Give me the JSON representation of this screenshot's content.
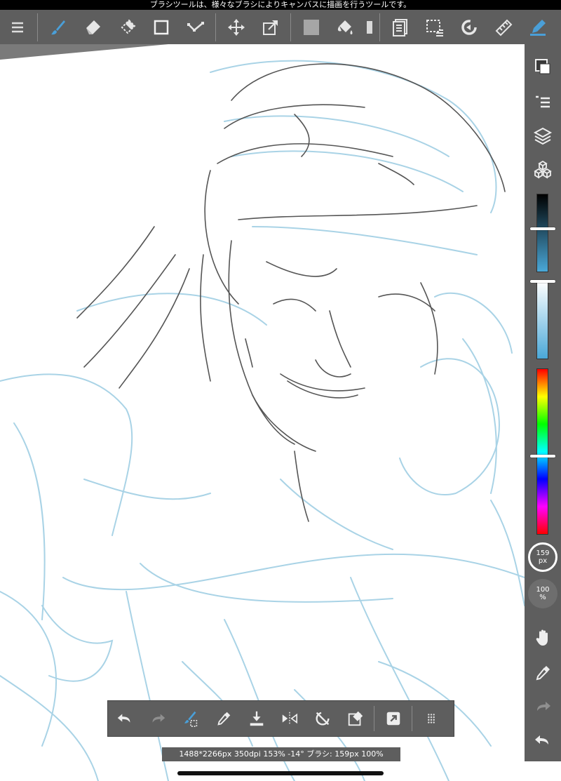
{
  "statusbar": {
    "message": "ブラシツールは、様々なブラシによりキャンバスに描画を行うツールです。"
  },
  "toolbar": {
    "tools": [
      {
        "icon": "menu-icon",
        "name": "menu-button"
      },
      {
        "icon": "brush-icon",
        "name": "brush-tool-button",
        "active": true
      },
      {
        "icon": "eraser-icon",
        "name": "eraser-tool-button"
      },
      {
        "icon": "blur-eraser-icon",
        "name": "blur-tool-button"
      },
      {
        "icon": "shape-rect-icon",
        "name": "shape-tool-button"
      },
      {
        "icon": "line-tool-icon",
        "name": "edit-tool-button"
      },
      {
        "icon": "move-icon",
        "name": "move-tool-button"
      },
      {
        "icon": "transform-icon",
        "name": "transform-tool-button"
      },
      {
        "icon": "fill-color-icon",
        "name": "fill-color-button"
      },
      {
        "icon": "bucket-icon",
        "name": "bucket-tool-button"
      },
      {
        "icon": "gradient-icon",
        "name": "gradient-tool-button"
      },
      {
        "icon": "layer-text-icon",
        "name": "text-tool-button"
      },
      {
        "icon": "select-icon",
        "name": "select-tool-button"
      },
      {
        "icon": "rotate-icon",
        "name": "rotate-tool-button"
      },
      {
        "icon": "ruler-icon",
        "name": "ruler-button"
      },
      {
        "icon": "pen-highlight-icon",
        "name": "pen-settings-button"
      }
    ]
  },
  "rightpanel": {
    "brush_size": {
      "value": "159",
      "unit": "px"
    },
    "opacity": {
      "value": "100",
      "unit": "%"
    }
  },
  "bottombar": {
    "buttons": [
      {
        "icon": "undo-icon",
        "name": "undo-button"
      },
      {
        "icon": "redo-icon",
        "name": "redo-button"
      },
      {
        "icon": "brush-select-icon",
        "name": "brush-select-button"
      },
      {
        "icon": "eyedropper-icon",
        "name": "eyedropper-button"
      },
      {
        "icon": "download-icon",
        "name": "save-layer-button"
      },
      {
        "icon": "flip-icon",
        "name": "flip-button"
      },
      {
        "icon": "rotate-reset-icon",
        "name": "rotate-reset-button"
      },
      {
        "icon": "clear-icon",
        "name": "clear-button"
      },
      {
        "icon": "expand-icon",
        "name": "expand-button"
      },
      {
        "icon": "grid-dots-icon",
        "name": "more-button"
      }
    ]
  },
  "infobar": {
    "text": "1488*2266px 350dpi 153% -14° ブラシ: 159px 100%"
  },
  "colors": {
    "panel": "#5e5e5e",
    "accent": "#4a9fd8",
    "sketch_blue": "#a9d3e6",
    "sketch_gray": "#555555"
  }
}
